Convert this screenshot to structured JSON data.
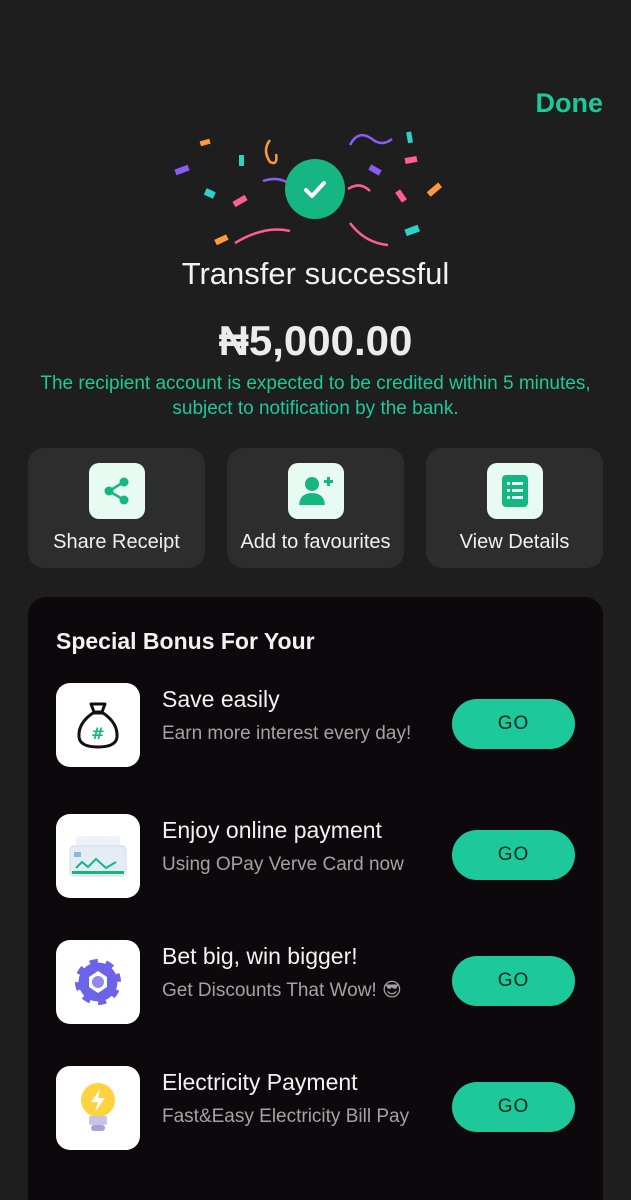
{
  "header": {
    "done_label": "Done"
  },
  "status": {
    "title": "Transfer successful",
    "amount": "₦5,000.00",
    "notice": "The recipient account is expected to be credited within 5 minutes, subject to notification by the bank."
  },
  "actions": [
    {
      "label": "Share Receipt",
      "icon": "share-icon"
    },
    {
      "label": "Add to favourites",
      "icon": "add-user-icon"
    },
    {
      "label": "View Details",
      "icon": "document-list-icon"
    }
  ],
  "bonus": {
    "title": "Special Bonus For Your",
    "items": [
      {
        "name": "Save easily",
        "desc": "Earn more interest every day!",
        "go_label": "GO",
        "icon": "money-bag-icon"
      },
      {
        "name": "Enjoy online payment",
        "desc": "Using OPay Verve Card now",
        "go_label": "GO",
        "icon": "card-icon"
      },
      {
        "name": "Bet big, win bigger!",
        "desc": "Get Discounts That Wow! 😎",
        "go_label": "GO",
        "icon": "chip-icon"
      },
      {
        "name": "Electricity Payment",
        "desc": "Fast&Easy Electricity Bill Pay",
        "go_label": "GO",
        "icon": "lightbulb-icon"
      }
    ]
  },
  "colors": {
    "accent": "#1dc99a",
    "background": "#1e1e1e",
    "card": "#2d2d2d",
    "panel": "#0d080b"
  }
}
